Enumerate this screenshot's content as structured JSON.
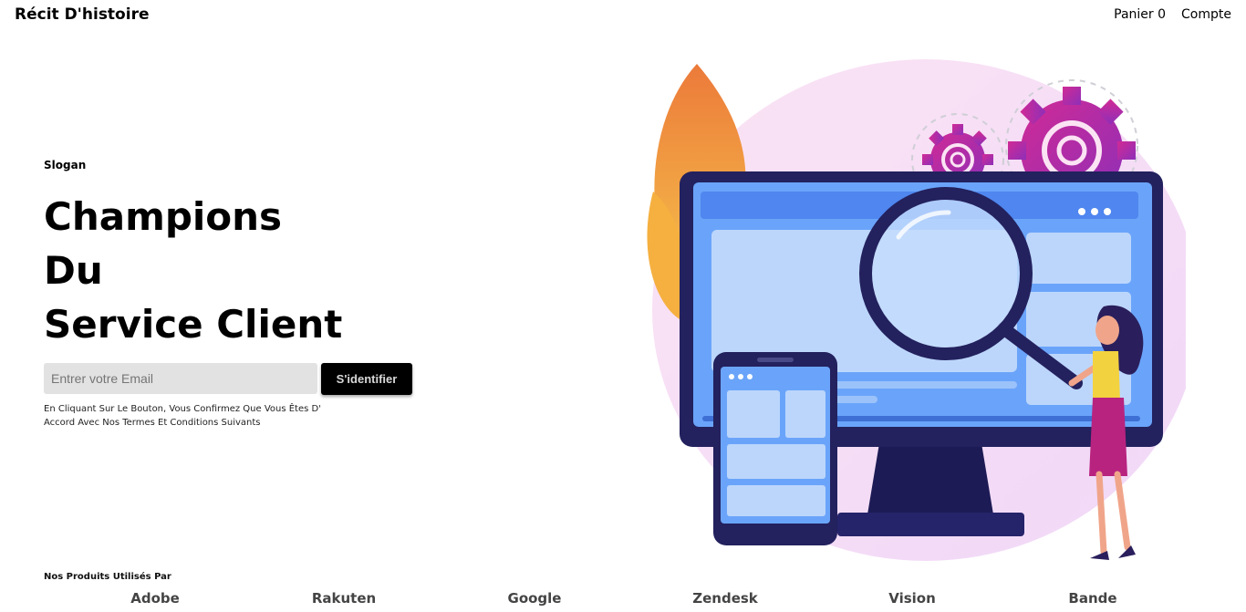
{
  "nav": {
    "brand": "Récit D'histoire",
    "cart": "Panier 0",
    "account": "Compte"
  },
  "hero": {
    "slogan": "Slogan",
    "headline": [
      "Champions",
      "Du",
      "Service Client"
    ],
    "email_placeholder": "Entrer votre Email",
    "login_label": "S'identifier",
    "terms_line1": "En Cliquant Sur Le Bouton, Vous Confirmez Que Vous Êtes D'",
    "terms_line2": "Accord Avec Nos Termes Et Conditions Suivants"
  },
  "products": {
    "title": "Nos Produits Utilisés Par",
    "partners": [
      "Adobe",
      "Rakuten",
      "Google",
      "Zendesk",
      "Vision",
      "Bande"
    ]
  },
  "illustration": {
    "icons": [
      "leaf-icon",
      "gear-icon",
      "monitor-icon",
      "magnifier-icon",
      "tablet-icon",
      "woman-figure"
    ],
    "colors": {
      "background_blob": "#f8dcf5",
      "leaf_orange": "#f08a3c",
      "leaf_yellow": "#f5c04a",
      "gear_purple": "#b523a6",
      "monitor_frame": "#23215e",
      "screen_blue": "#5b9bf7",
      "panel_light": "#bcd6fb",
      "skirt_magenta": "#b8237f",
      "shirt_yellow": "#f3d23f"
    }
  }
}
